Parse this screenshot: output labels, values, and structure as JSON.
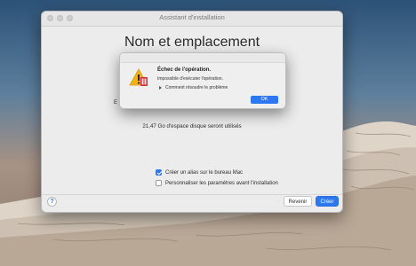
{
  "window": {
    "title": "Assistant d'installation",
    "heading": "Nom et emplacement",
    "partial_label": "E",
    "disk_info": "21,47 Go d'espace disque seront utilisés",
    "options": [
      {
        "label": "Créer un alias sur le bureau Mac",
        "checked": true
      },
      {
        "label": "Personnaliser les paramètres avant l'installation",
        "checked": false
      }
    ],
    "help_symbol": "?",
    "back_label": "Revenir",
    "create_label": "Créer"
  },
  "alert": {
    "title": "Échec de l'opération.",
    "message": "Impossible d'exécuter l'opération.",
    "link": "Comment résoudre le problème",
    "ok_label": "OK",
    "icon": "parallels-warning-icon"
  },
  "colors": {
    "accent": "#2b78f2",
    "warning": "#f2b316"
  }
}
